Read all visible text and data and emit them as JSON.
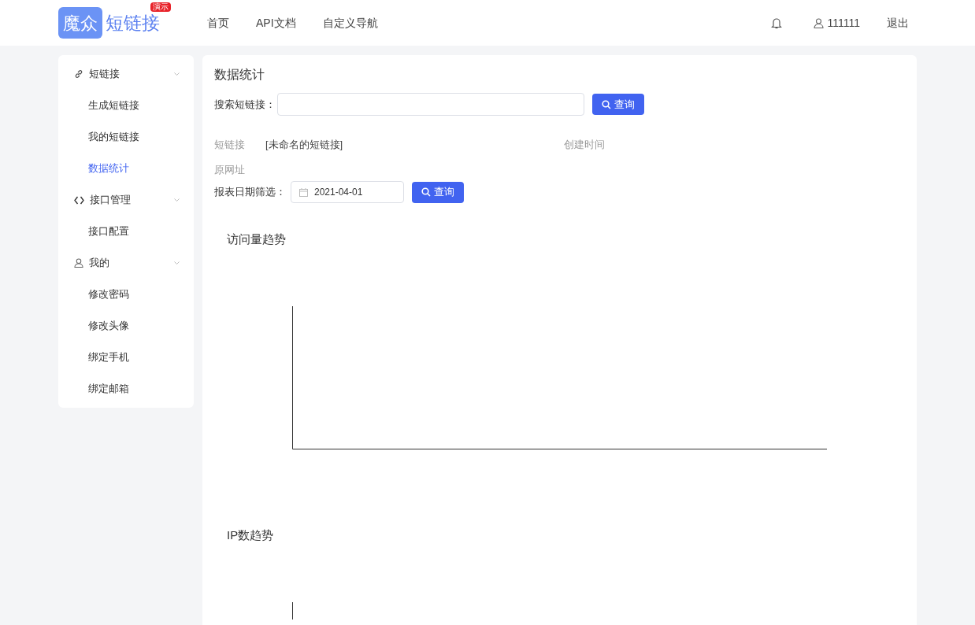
{
  "header": {
    "logo": {
      "mark": "魔众",
      "name": "短链接",
      "badge": "演示"
    },
    "nav": [
      {
        "label": "首页"
      },
      {
        "label": "API文档"
      },
      {
        "label": "自定义导航"
      }
    ],
    "user": "111111",
    "logout": "退出"
  },
  "sidebar": {
    "groups": [
      {
        "label": "短链接",
        "expanded": true,
        "items": [
          {
            "label": "生成短链接",
            "selected": false
          },
          {
            "label": "我的短链接",
            "selected": false
          },
          {
            "label": "数据统计",
            "selected": true
          }
        ]
      },
      {
        "label": "接口管理",
        "expanded": true,
        "items": [
          {
            "label": "接口配置",
            "selected": false
          }
        ]
      },
      {
        "label": "我的",
        "expanded": true,
        "items": [
          {
            "label": "修改密码",
            "selected": false
          },
          {
            "label": "修改头像",
            "selected": false
          },
          {
            "label": "绑定手机",
            "selected": false
          },
          {
            "label": "绑定邮箱",
            "selected": false
          }
        ]
      }
    ]
  },
  "main": {
    "title": "数据统计",
    "search": {
      "label": "搜索短链接：",
      "button": "查询"
    },
    "info": {
      "short_link_label": "短链接",
      "short_link_value": "[未命名的短链接]",
      "created_label": "创建时间",
      "url_label": "原网址"
    },
    "date_filter": {
      "label": "报表日期筛选：",
      "value": "2021-04-01",
      "button": "查询"
    },
    "charts": [
      {
        "title": "访问量趋势"
      },
      {
        "title": "IP数趋势"
      }
    ]
  }
}
